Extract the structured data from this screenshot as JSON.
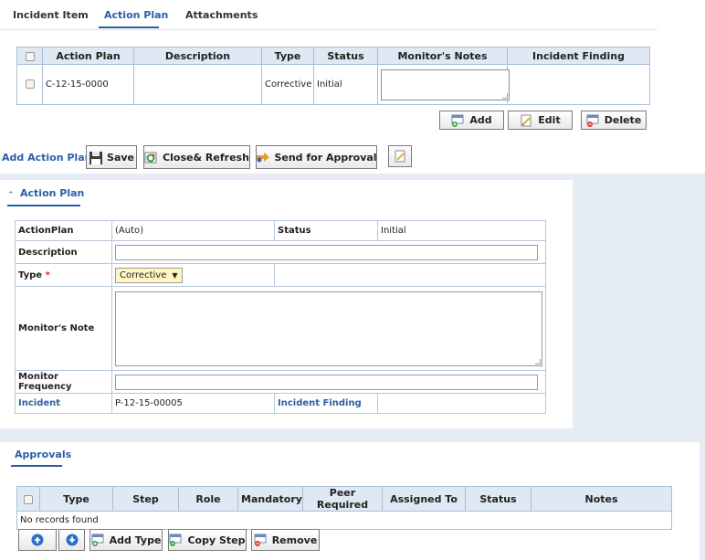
{
  "tabs": [
    "Incident Item",
    "Action Plan",
    "Attachments"
  ],
  "action_grid": {
    "headers": [
      "Action Plan",
      "Description",
      "Type",
      "Status",
      "Monitor's Notes",
      "Incident Finding"
    ],
    "row": {
      "action_plan": "C-12-15-0000",
      "description": "",
      "type": "Corrective",
      "status": "Initial",
      "incident_finding": ""
    }
  },
  "grid_buttons": {
    "add": "Add",
    "edit": "Edit",
    "delete": "Delete"
  },
  "toolbar": {
    "title": "Add Action Plan",
    "save": "Save",
    "close_refresh": "Close& Refresh",
    "send_approval": "Send for Approval"
  },
  "action_plan_section": {
    "title": "Action Plan",
    "actionplan_label": "ActionPlan",
    "actionplan_value": "(Auto)",
    "status_label": "Status",
    "status_value": "Initial",
    "description_label": "Description",
    "type_label": "Type",
    "type_required": "*",
    "type_value": "Corrective",
    "monitor_note_label": "Monitor's Note",
    "monitor_frequency_label": "Monitor Frequency",
    "incident_label": "Incident",
    "incident_value": "P-12-15-00005",
    "incident_finding_label": "Incident Finding"
  },
  "approvals": {
    "title": "Approvals",
    "headers": [
      "Type",
      "Step",
      "Role",
      "Mandatory",
      "Peer Required",
      "Assigned To",
      "Status",
      "Notes"
    ],
    "empty_text": "No records found",
    "buttons": {
      "add_type": "Add Type",
      "copy_step": "Copy Step",
      "remove": "Remove"
    }
  },
  "colors": {
    "accent": "#2a5fa5",
    "header_bg": "#dfe8f3",
    "gray_bg": "#e6ecf3",
    "select_bg": "#fff6c2"
  }
}
